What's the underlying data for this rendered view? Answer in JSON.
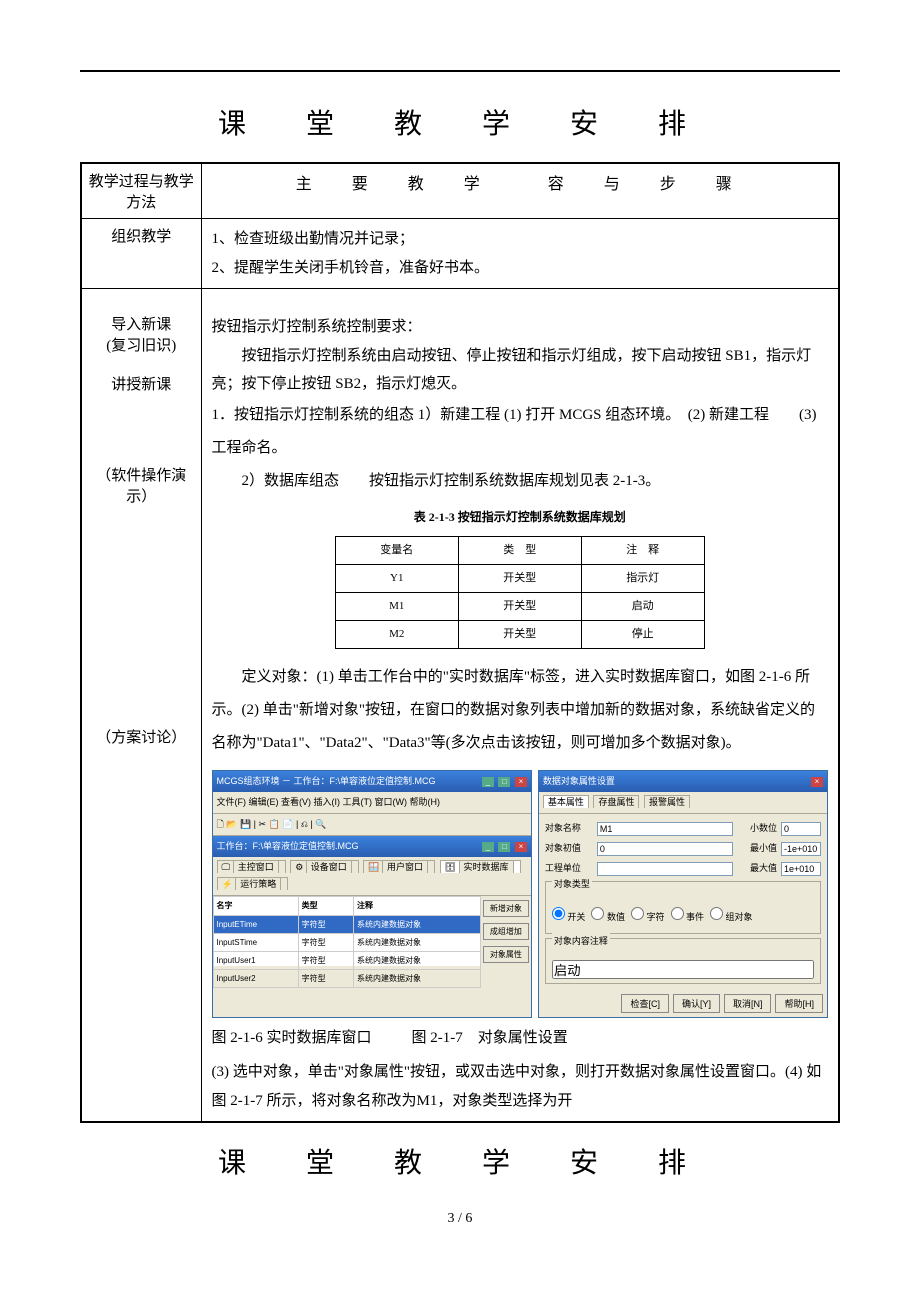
{
  "page": {
    "title_top": "课　堂　教　学　安　排",
    "title_bottom": "课　堂　教　学　安　排",
    "page_num": "3 / 6"
  },
  "header_row": {
    "left": "教学过程与教学方法",
    "right": "主　要　教　学　　容　与　步　骤"
  },
  "sections": [
    {
      "left": "组织教学",
      "right_lines": [
        "1、检查班级出勤情况并记录；",
        "2、提醒学生关闭手机铃音，准备好书本。"
      ]
    },
    {
      "left_multi": [
        "导入新课",
        "(复习旧识)",
        "",
        "讲授新课",
        "",
        "",
        "",
        "（软件操作演示）",
        "",
        "",
        "",
        "",
        "",
        "",
        "",
        "（方案讨论）"
      ],
      "intro_title": "按钮指示灯控制系统控制要求：",
      "intro_body": "　　按钮指示灯控制系统由启动按钮、停止按钮和指示灯组成，按下启动按钮 SB1，指示灯亮；按下停止按钮 SB2，指示灯熄灭。",
      "step1_a": "1．按钮指示灯控制系统的组态 1）新建工程 (1) 打开 MCGS 组态环境。　(2) 新建工程　　(3) 工程命名。",
      "step1_b": "　　2）数据库组态　　按钮指示灯控制系统数据库规划见表 2-1-3。",
      "table_caption": "表 2-1-3  按钮指示灯控制系统数据库规划",
      "table_headers": [
        "变量名",
        "类　型",
        "注　释"
      ],
      "table_rows": [
        [
          "Y1",
          "开关型",
          "指示灯"
        ],
        [
          "M1",
          "开关型",
          "启动"
        ],
        [
          "M2",
          "开关型",
          "停止"
        ]
      ],
      "para2": "　　定义对象：(1) 单击工作台中的\"实时数据库\"标签，进入实时数据库窗口，如图 2-1-6 所示。(2) 单击\"新增对象\"按钮，在窗口的数据对象列表中增加新的数据对象，系统缺省定义的名称为\"Data1\"、\"Data2\"、\"Data3\"等(多次点击该按钮，则可增加多个数据对象)。",
      "fig_caption_1": "图 2-1-6 实时数据库窗口",
      "fig_caption_2": "图 2-1-7　对象属性设置",
      "para3": "(3) 选中对象，单击\"对象属性\"按钮，或双击选中对象，则打开数据对象属性设置窗口。(4) 如图 2-1-7 所示，将对象名称改为M1，对象类型选择为开"
    }
  ],
  "screenshot1": {
    "outer_title": "MCGS组态环境 － 工作台：F:\\单容液位定值控制.MCG",
    "menu": "文件(F)  编辑(E)  查看(V)  插入(I)  工具(T)  窗口(W)  帮助(H)",
    "toolbar": "🗋 📂 💾 | ✂ 📋 📄 | ⎌ | 🔍",
    "inner_title": "工作台：F:\\单容液位定值控制.MCG",
    "tabs": [
      "主控窗口",
      "设备窗口",
      "用户窗口",
      "实时数据库",
      "运行策略"
    ],
    "active_tab": 3,
    "list_headers": [
      "名字",
      "类型",
      "注释"
    ],
    "list_rows": [
      [
        "InputETime",
        "字符型",
        "系统内建数据对象"
      ],
      [
        "InputSTime",
        "字符型",
        "系统内建数据对象"
      ],
      [
        "InputUser1",
        "字符型",
        "系统内建数据对象"
      ],
      [
        "InputUser2",
        "字符型",
        "系统内建数据对象"
      ]
    ],
    "side_buttons": [
      "新增对象",
      "成组增加",
      "对象属性"
    ]
  },
  "screenshot2": {
    "title": "数据对象属性设置",
    "tabs": [
      "基本属性",
      "存盘属性",
      "报警属性"
    ],
    "active_tab": 0,
    "obj_name_label": "对象名称",
    "obj_name_val": "M1",
    "decimals_label": "小数位",
    "decimals_val": "0",
    "init_label": "对象初值",
    "init_val": "0",
    "min_label": "最小值",
    "min_val": "-1e+010",
    "unit_label": "工程单位",
    "unit_val": "",
    "max_label": "最大值",
    "max_val": "1e+010",
    "type_group": "对象类型",
    "radios": [
      "开关",
      "数值",
      "字符",
      "事件",
      "组对象"
    ],
    "radio_checked": 0,
    "comment_group": "对象内容注释",
    "comment_val": "启动",
    "buttons": [
      "检查[C]",
      "确认[Y]",
      "取消[N]",
      "帮助[H]"
    ]
  }
}
